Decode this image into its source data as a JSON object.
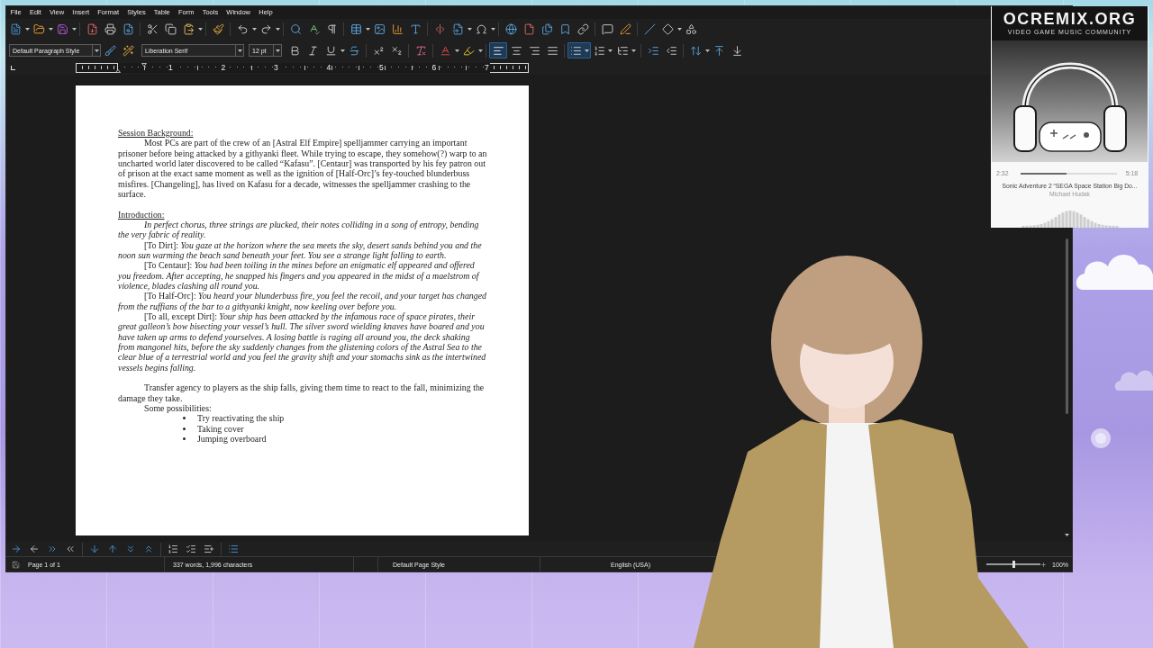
{
  "menu_bar": [
    "File",
    "Edit",
    "View",
    "Insert",
    "Format",
    "Styles",
    "Table",
    "Form",
    "Tools",
    "Window",
    "Help"
  ],
  "formatting_toolbar": {
    "paragraph_style": "Default Paragraph Style",
    "font_name": "Liberation Serif",
    "font_size": "12 pt",
    "alignment": [
      {
        "selected": true
      },
      {
        "selected": false
      },
      {
        "selected": false
      },
      {
        "selected": false
      }
    ],
    "lists": [
      {
        "selected": true
      },
      {
        "selected": false
      },
      {
        "selected": false
      }
    ]
  },
  "ruler": {
    "labels": [
      "1",
      "2",
      "3",
      "4",
      "5",
      "6",
      "7"
    ]
  },
  "document": {
    "sections": [
      {
        "heading": "Session Background:",
        "paragraphs": [
          {
            "text": "Most PCs are part of the crew of an [Astral Elf Empire] spelljammer carrying an important prisoner before being attacked by a githyanki fleet. While trying to escape, they somehow(?) warp to an uncharted world later discovered to be called “Kafasu”. [Centaur] was transported by his fey patron out of prison at the exact same moment as well as the ignition of [Half-Orc]’s fey-touched blunderbuss misfires. [Changeling], has lived on Kafasu for a decade, witnesses the spelljammer crashing to the surface.",
            "italic": false
          }
        ]
      },
      {
        "heading": "Introduction:",
        "paragraphs": [
          {
            "text": "In perfect chorus, three strings are plucked, their notes colliding in a song of entropy, bending the very fabric of reality.",
            "italic": true
          },
          {
            "text": "[To Dirt]: *You gaze at the horizon where the sea meets the sky, desert sands behind you and the noon sun warming the beach sand beneath your feet. You see a strange light falling to earth.*",
            "italic": false
          },
          {
            "text": "[To Centaur]: *You had been toiling in the mines before an enigmatic elf appeared and offered you freedom. After accepting, he snapped his fingers and you appeared in the midst of a maelstrom of violence, blades clashing all round you.*",
            "italic": false
          },
          {
            "text": "[To Half-Orc]: *You heard your blunderbuss fire, you feel the recoil, and your target has changed from the ruffians of the bar to a githyanki knight, now keeling over before you.*",
            "italic": false
          },
          {
            "text": "[To all, except Dirt]: *Your ship has been attacked by the infamous race of space pirates, their great galleon’s bow bisecting your vessel’s hull. The silver sword wielding knaves have boared and you have taken up arms to defend yourselves. A losing battle is raging all around you, the deck shaking from mangonel hits, before the sky suddenly changes from the glistening colors of the Astral Sea to the clear blue of a terrestrial world and you feel the gravity shift and your stomachs sink as the intertwined vessels begins falling.*",
            "italic": false
          }
        ]
      },
      {
        "paragraphs": [
          {
            "text": "Transfer agency to players as the ship falls, giving them time to react to the fall, minimizing the damage they take.",
            "italic": false
          },
          {
            "text": "Some possibilities:",
            "italic": false
          }
        ],
        "bullets": [
          "Try reactivating the ship",
          "Taking cover",
          "Jumping overboard"
        ]
      }
    ]
  },
  "status_bar": {
    "page": "Page 1 of 1",
    "word_count": "337 words, 1,996 characters",
    "page_style": "Default Page Style",
    "language": "English (USA)",
    "zoom_slider": {
      "level": 0.5
    },
    "zoom": "100%"
  },
  "music_widget": {
    "album_art": {
      "logo": "OCREMIX.ORG",
      "tagline": "VIDEO GAME MUSIC COMMUNITY"
    },
    "elapsed": "2:32",
    "progress": {
      "level": 0.48
    },
    "duration": "5:18",
    "title": "Sonic Adventure 2 “SEGA Space Station Big Do...",
    "artist": "Michael Hudak"
  }
}
